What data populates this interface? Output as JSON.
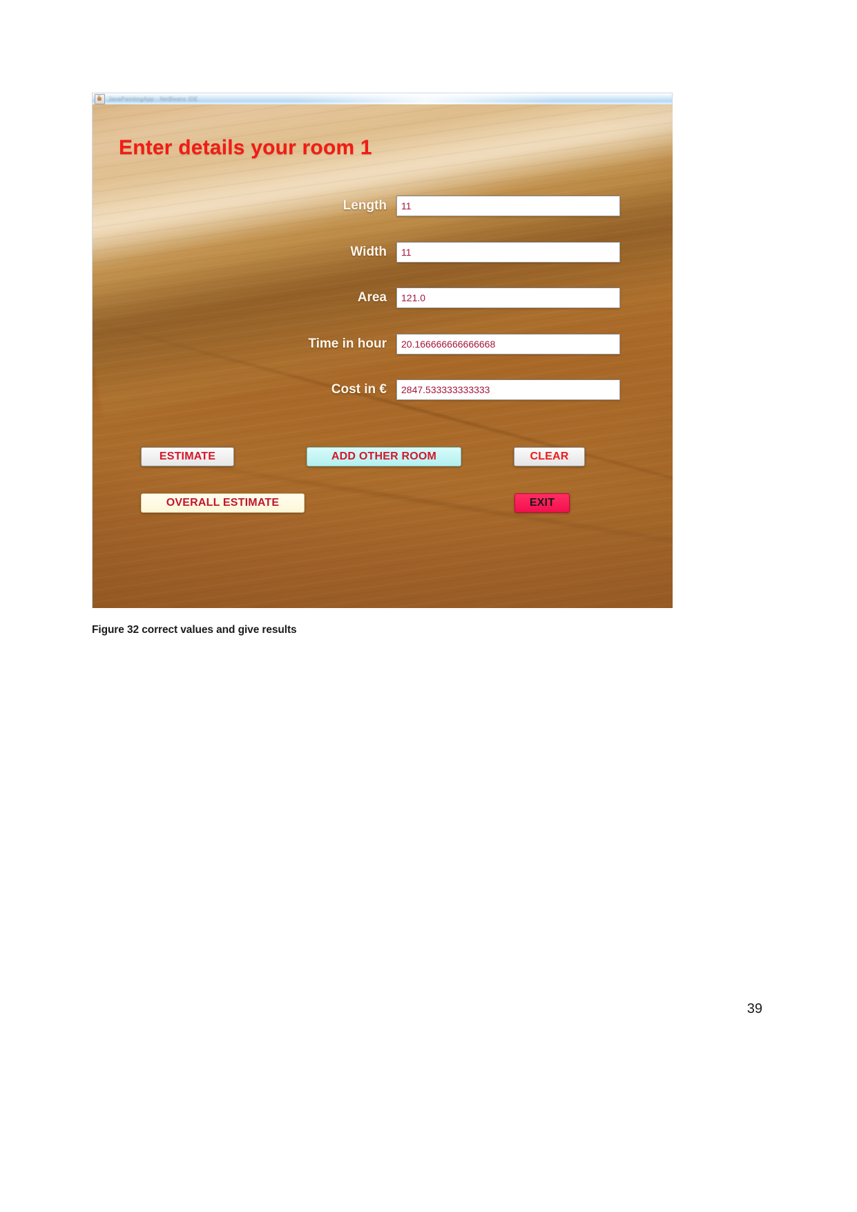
{
  "document": {
    "figure_caption": "Figure 32 correct values and give results",
    "page_number": "39"
  },
  "app_window": {
    "titlebar": {
      "icon": "java-coffee-cup-icon",
      "title": "JavaPaintingApp - NetBeans IDE"
    },
    "heading": "Enter details your room 1",
    "fields": [
      {
        "label": "Length",
        "value": "11"
      },
      {
        "label": "Width",
        "value": "11"
      },
      {
        "label": "Area",
        "value": "121.0"
      },
      {
        "label": "Time in hour",
        "value": "20.166666666666668"
      },
      {
        "label": "Cost in €",
        "value": "2847.533333333333"
      }
    ],
    "buttons": {
      "estimate": "ESTIMATE",
      "add_other_room": "ADD OTHER ROOM",
      "clear": "CLEAR",
      "overall_estimate": "OVERALL ESTIMATE",
      "exit": "EXIT"
    },
    "colors": {
      "heading_red": "#f21c14",
      "label_white": "#fdf6ec",
      "value_red": "#a3153a",
      "button_text_red": "#d2182a",
      "add_room_bg": "#b3f0ef",
      "overall_bg": "#fdf7d9",
      "exit_bg": "#f3104f",
      "wood_background": "#ab6c2c"
    }
  }
}
